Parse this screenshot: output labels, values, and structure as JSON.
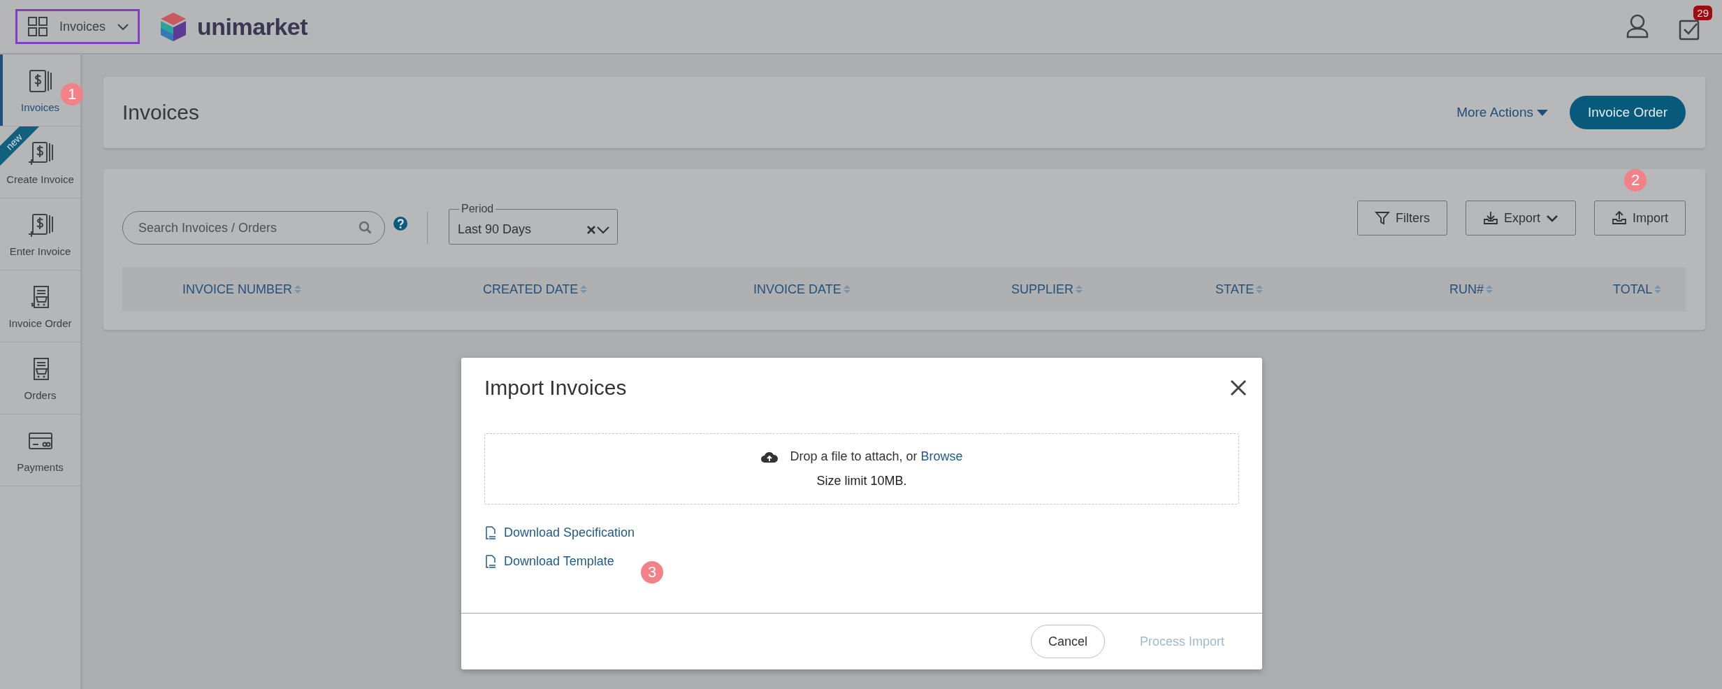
{
  "app_switcher": {
    "label": "Invoices"
  },
  "logo": {
    "text": "unimarket"
  },
  "tasks": {
    "badge": "29"
  },
  "sidebar": {
    "items": [
      {
        "label": "Invoices",
        "selected": true
      },
      {
        "label": "Create Invoice",
        "selected": false,
        "badge": "new"
      },
      {
        "label": "Enter Invoice",
        "selected": false
      },
      {
        "label": "Invoice Order",
        "selected": false
      },
      {
        "label": "Orders",
        "selected": false
      },
      {
        "label": "Payments",
        "selected": false
      }
    ]
  },
  "header": {
    "title": "Invoices",
    "more_actions": "More Actions",
    "primary_button": "Invoice Order"
  },
  "filters": {
    "search": {
      "placeholder": "Search Invoices / Orders"
    },
    "period": {
      "label": "Period",
      "value": "Last 90 Days"
    },
    "buttons": [
      {
        "label": "Filters",
        "dropdown": false
      },
      {
        "label": "Export",
        "dropdown": true
      },
      {
        "label": "Import",
        "dropdown": false
      }
    ]
  },
  "table": {
    "columns": [
      "INVOICE NUMBER",
      "CREATED DATE",
      "INVOICE DATE",
      "SUPPLIER",
      "STATE",
      "RUN#",
      "TOTAL"
    ]
  },
  "dialog": {
    "title": "Import Invoices",
    "drop_text": "Drop a file to attach, or ",
    "browse": "Browse",
    "size_limit": "Size limit 10MB.",
    "links": [
      "Download Specification",
      "Download Template"
    ],
    "buttons": [
      {
        "label": "Cancel",
        "disabled": false
      },
      {
        "label": "Process Import",
        "disabled": true
      }
    ]
  },
  "annotations": [
    "1",
    "2",
    "3"
  ]
}
